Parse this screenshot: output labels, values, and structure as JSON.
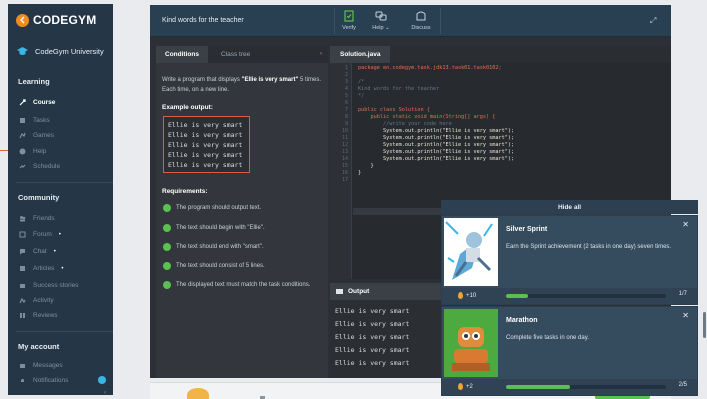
{
  "app": {
    "logo_text": "CODEGYM",
    "university": "CodeGym University"
  },
  "sidebar": {
    "sections": [
      {
        "label": "Learning",
        "items": [
          {
            "label": "Course",
            "icon": "course-icon",
            "active": true
          },
          {
            "label": "Tasks",
            "icon": "tasks-icon"
          },
          {
            "label": "Games",
            "icon": "games-icon"
          },
          {
            "label": "Help",
            "icon": "help-icon"
          },
          {
            "label": "Schedule",
            "icon": "schedule-icon"
          }
        ]
      },
      {
        "label": "Community",
        "items": [
          {
            "label": "Friends",
            "icon": "friends-icon"
          },
          {
            "label": "Forum",
            "icon": "forum-icon",
            "dot": true
          },
          {
            "label": "Chat",
            "icon": "chat-icon",
            "dot": true
          },
          {
            "label": "Articles",
            "icon": "articles-icon",
            "dot": true
          },
          {
            "label": "Success stories",
            "icon": "success-stories-icon"
          },
          {
            "label": "Activity",
            "icon": "activity-icon"
          },
          {
            "label": "Reviews",
            "icon": "reviews-icon"
          }
        ]
      },
      {
        "label": "My account",
        "items": [
          {
            "label": "Messages",
            "icon": "messages-icon"
          },
          {
            "label": "Notifications",
            "icon": "notifications-icon"
          }
        ]
      }
    ]
  },
  "task": {
    "title": "Kind words for the teacher"
  },
  "toolbar": {
    "verify_label": "Verify",
    "help_label": "Help ⌄",
    "discuss_label": "Discuss"
  },
  "conditions": {
    "tab_conditions": "Conditions",
    "tab_class_tree": "Class tree",
    "text_before": "Write a program that displays ",
    "text_bold": "\"Ellie is very smart\"",
    "text_after": " 5 times. Each time, on a new line.",
    "example_label": "Example output:",
    "example_lines": [
      "Ellie is very smart",
      "Ellie is very smart",
      "Ellie is very smart",
      "Ellie is very smart",
      "Ellie is very smart"
    ],
    "requirements_label": "Requirements:",
    "requirements": [
      "The program should output text.",
      "The text should begin with \"Ellie\".",
      "The text should end with \"smart\".",
      "The text should consist of 5 lines.",
      "The displayed text must match the task conditions."
    ]
  },
  "editor": {
    "file_tab": "Solution.java",
    "line_numbers": [
      "1",
      "2",
      "3",
      "4",
      "5",
      "6",
      "7",
      "8",
      "9",
      "10",
      "11",
      "12",
      "13",
      "14",
      "15",
      "16",
      "17"
    ],
    "package_line": "package en.codegym.task.jdk13.task01.task0102;",
    "comment_open": "/*",
    "comment_body": "Kind words for the teacher",
    "comment_close": "*/",
    "class_line": "public class Solution {",
    "main_line": "    public static void main(String[] args) {",
    "todo_line": "        //write your code here",
    "println_line": "        System.out.println(\"Ellie is very smart\");",
    "close_method": "    }",
    "close_class": "}"
  },
  "output": {
    "label": "Output",
    "lines": [
      "Ellie is very smart",
      "Ellie is very smart",
      "Ellie is very smart",
      "Ellie is very smart",
      "Ellie is very smart"
    ]
  },
  "notifications": {
    "hide_all_label": "Hide all",
    "cards": [
      {
        "title": "Silver Sprint",
        "description": "Earn the Sprint achievement (2 tasks in one day) seven times.",
        "reward": "+10",
        "progress": 0.14,
        "count": "1/7"
      },
      {
        "title": "Marathon",
        "description": "Complete five tasks in one day.",
        "reward": "+2",
        "progress": 0.4,
        "count": "2/5"
      }
    ]
  },
  "colors": {
    "accent": "#f28b1e",
    "success": "#5cc050",
    "error_border": "#e05a3c"
  }
}
